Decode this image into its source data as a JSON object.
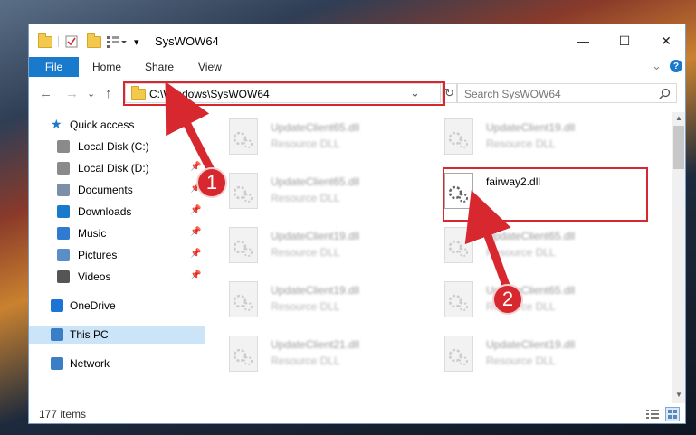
{
  "window": {
    "title": "SysWOW64",
    "min": "—",
    "max": "☐",
    "close": "✕"
  },
  "ribbon": {
    "tabs": [
      "File",
      "Home",
      "Share",
      "View"
    ],
    "expand": "⌄",
    "help": "?"
  },
  "address": {
    "path": "C:\\Windows\\SysWOW64",
    "dropdown": "⌄",
    "refresh": "↻"
  },
  "search": {
    "placeholder": "Search SysWOW64",
    "icon": "search-icon"
  },
  "nav": {
    "back": "←",
    "forward": "→",
    "dropdown": "⌄",
    "up": "↑"
  },
  "sidebar": [
    {
      "label": "Quick access",
      "icon": "star-icon",
      "pinned": false
    },
    {
      "label": "Local Disk (C:)",
      "icon": "disk-icon",
      "pinned": false
    },
    {
      "label": "Local Disk (D:)",
      "icon": "disk-icon",
      "pinned": true
    },
    {
      "label": "Documents",
      "icon": "documents-icon",
      "pinned": true
    },
    {
      "label": "Downloads",
      "icon": "downloads-icon",
      "pinned": true
    },
    {
      "label": "Music",
      "icon": "music-icon",
      "pinned": true
    },
    {
      "label": "Pictures",
      "icon": "pictures-icon",
      "pinned": true
    },
    {
      "label": "Videos",
      "icon": "videos-icon",
      "pinned": true
    },
    {
      "label": "OneDrive",
      "icon": "cloud-icon",
      "pinned": false
    },
    {
      "label": "This PC",
      "icon": "pc-icon",
      "pinned": false,
      "selected": true
    },
    {
      "label": "Network",
      "icon": "network-icon",
      "pinned": false
    }
  ],
  "files": [
    {
      "name": "UpdateClient65.dll",
      "type": "Resource DLL"
    },
    {
      "name": "UpdateClient19.dll",
      "type": "Resource DLL"
    },
    {
      "name": "UpdateClient65.dll",
      "type": "Resource DLL"
    },
    {
      "name": "fairway2.dll",
      "type": ""
    },
    {
      "name": "UpdateClient19.dll",
      "type": "Resource DLL"
    },
    {
      "name": "UpdateClient65.dll",
      "type": "Resource DLL"
    },
    {
      "name": "UpdateClient19.dll",
      "type": "Resource DLL"
    },
    {
      "name": "UpdateClient65.dll",
      "type": "Resource DLL"
    },
    {
      "name": "UpdateClient21.dll",
      "type": "Resource DLL"
    },
    {
      "name": "UpdateClient19.dll",
      "type": "Resource DLL"
    }
  ],
  "status": {
    "items": "177 items"
  },
  "annotations": {
    "step1": "1",
    "step2": "2",
    "color": "#d7282f"
  }
}
